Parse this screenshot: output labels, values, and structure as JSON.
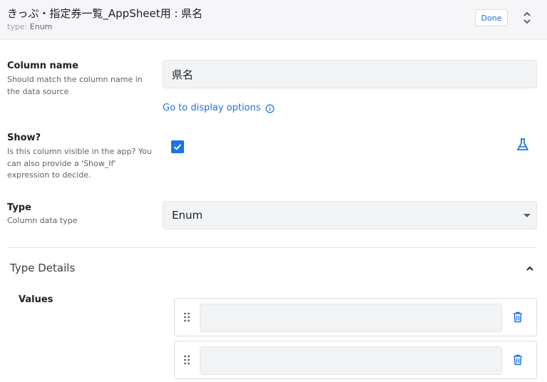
{
  "header": {
    "title": "きっぷ・指定券一覧_AppSheet用 : 県名",
    "type_prefix": "type:",
    "type_value": "Enum",
    "done_label": "Done"
  },
  "column_name": {
    "label": "Column name",
    "help": "Should match the column name in the data source",
    "value": "県名",
    "display_options_link": "Go to display options"
  },
  "show": {
    "label": "Show?",
    "help": "Is this column visible in the app? You can also provide a 'Show_If' expression to decide.",
    "checked": true
  },
  "type": {
    "label": "Type",
    "help": "Column data type",
    "value": "Enum"
  },
  "type_details": {
    "title": "Type Details",
    "values_label": "Values",
    "values": [
      "",
      ""
    ]
  },
  "colors": {
    "accent": "#1a73e8",
    "field_bg": "#f1f3f4"
  }
}
